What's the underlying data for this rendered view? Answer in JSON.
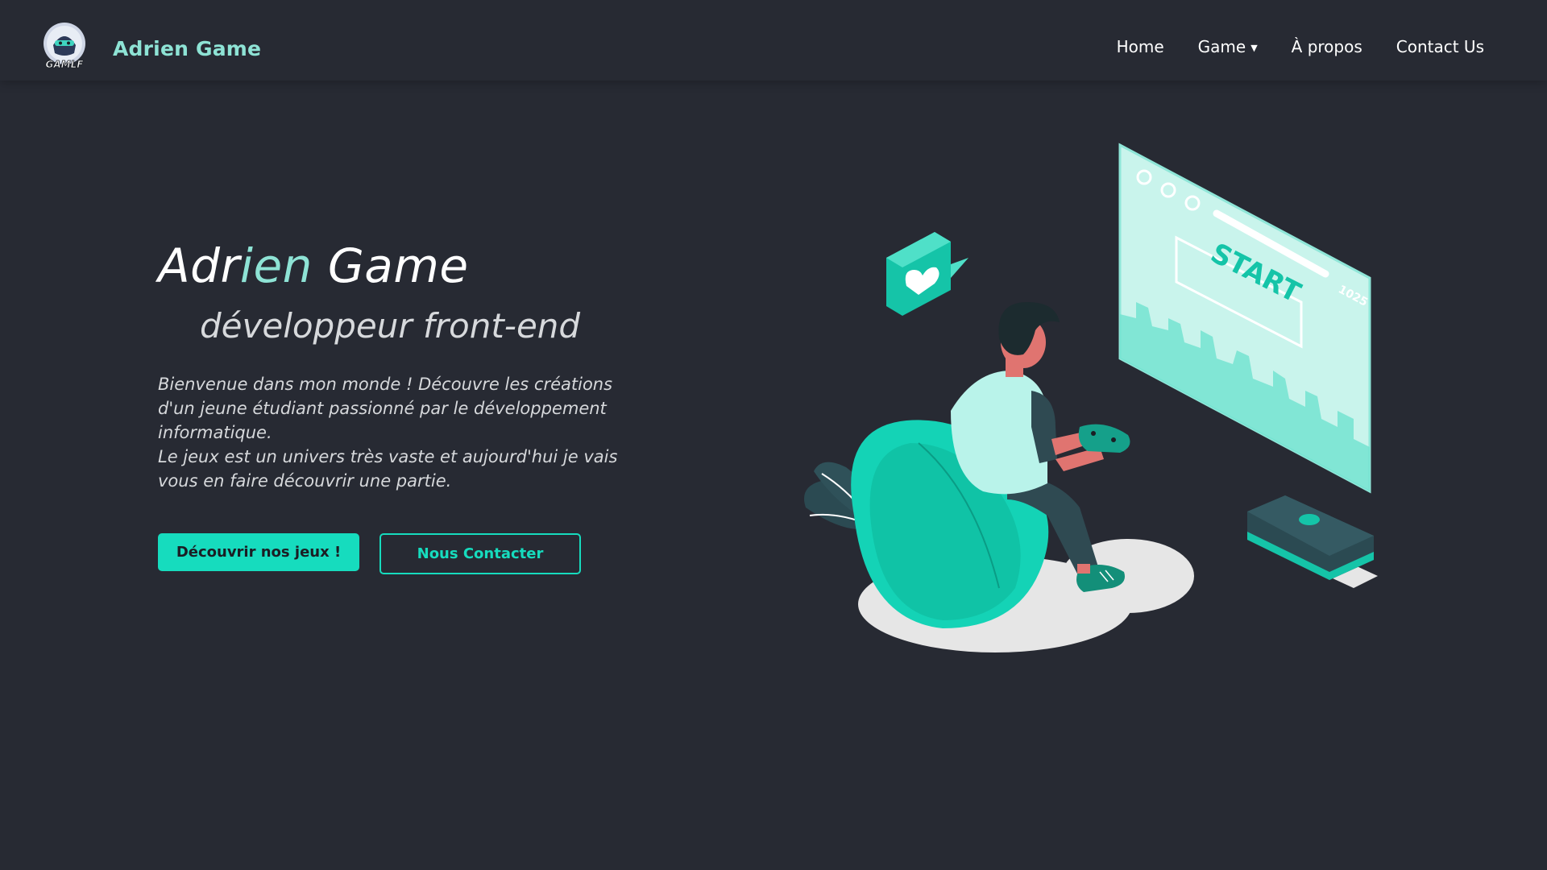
{
  "header": {
    "brand": "Adrien Game",
    "logo_text": "GAMLF",
    "nav": [
      {
        "label": "Home"
      },
      {
        "label": "Game",
        "icon": "caret-down-icon"
      },
      {
        "label": "À propos"
      },
      {
        "label": "Contact Us"
      }
    ]
  },
  "hero": {
    "title_part1": "Adr",
    "title_accent": "ien",
    "title_part2": " Game",
    "subtitle": "développeur front-end",
    "paragraph_line1": "Bienvenue dans mon monde ! Découvre les créations d'un jeune étudiant passionné par le développement informatique.",
    "paragraph_line2": "Le jeux est un univers très vaste et aujourd'hui je vais vous en faire découvrir une partie.",
    "primary_button": "Découvrir nos jeux !",
    "secondary_button": "Nous Contacter"
  },
  "illustration": {
    "screen_text": "START",
    "score_text": "1025"
  },
  "colors": {
    "background": "#272a33",
    "accent": "#8ee3d5",
    "brand_green": "#16dcbe"
  }
}
